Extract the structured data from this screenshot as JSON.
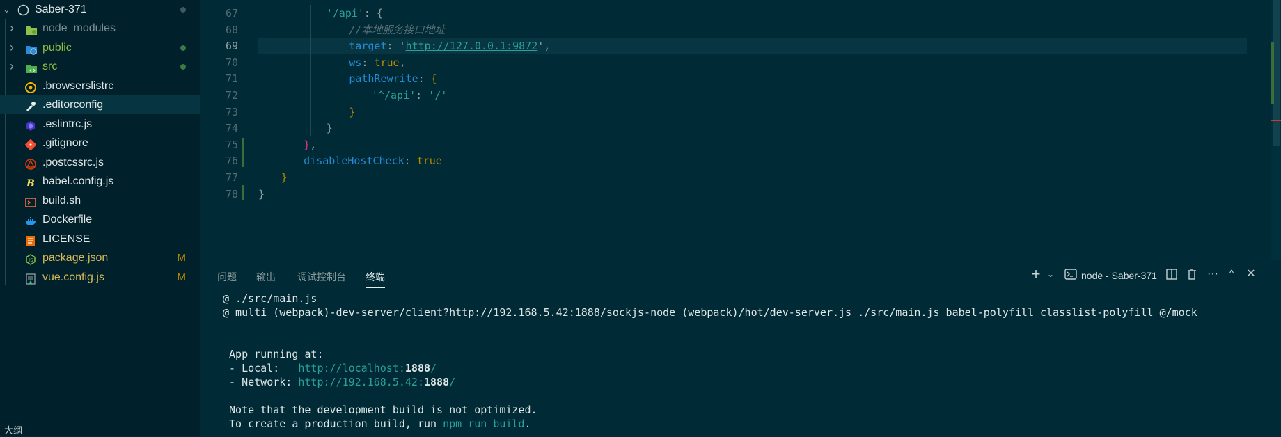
{
  "explorer": {
    "root_label": "Saber-371",
    "items": [
      {
        "label": "node_modules",
        "type": "folder",
        "icon": "node-folder-icon",
        "color": "#7f8c8d",
        "status": ""
      },
      {
        "label": "public",
        "type": "folder",
        "icon": "globe-folder-icon",
        "color": "#8fbf3f",
        "status": "dot"
      },
      {
        "label": "src",
        "type": "folder",
        "icon": "src-folder-icon",
        "color": "#8fbf3f",
        "status": "dot"
      },
      {
        "label": ".browserslistrc",
        "type": "file",
        "icon": "browserslist-icon",
        "color": "#e0e6e6",
        "status": ""
      },
      {
        "label": ".editorconfig",
        "type": "file",
        "icon": "editorconfig-icon",
        "color": "#e0e6e6",
        "status": ""
      },
      {
        "label": ".eslintrc.js",
        "type": "file",
        "icon": "eslint-icon",
        "color": "#e0e6e6",
        "status": ""
      },
      {
        "label": ".gitignore",
        "type": "file",
        "icon": "git-icon",
        "color": "#e0e6e6",
        "status": ""
      },
      {
        "label": ".postcssrc.js",
        "type": "file",
        "icon": "postcss-icon",
        "color": "#e0e6e6",
        "status": ""
      },
      {
        "label": "babel.config.js",
        "type": "file",
        "icon": "babel-icon",
        "color": "#e0e6e6",
        "status": ""
      },
      {
        "label": "build.sh",
        "type": "file",
        "icon": "shell-icon",
        "color": "#e0e6e6",
        "status": ""
      },
      {
        "label": "Dockerfile",
        "type": "file",
        "icon": "docker-icon",
        "color": "#e0e6e6",
        "status": ""
      },
      {
        "label": "LICENSE",
        "type": "file",
        "icon": "license-icon",
        "color": "#e0e6e6",
        "status": ""
      },
      {
        "label": "package.json",
        "type": "file",
        "icon": "nodejs-icon",
        "color": "#d8b85a",
        "status": "M"
      },
      {
        "label": "vue.config.js",
        "type": "file",
        "icon": "vue-config-icon",
        "color": "#d8b85a",
        "status": "M"
      }
    ],
    "selected_index": 4,
    "outline_label": "大纲"
  },
  "editor": {
    "lines": [
      {
        "num": "67",
        "indent": 6,
        "tokens": [
          [
            "'/api'",
            "str"
          ],
          [
            ": ",
            "punc"
          ],
          [
            "{",
            "brace"
          ]
        ]
      },
      {
        "num": "68",
        "indent": 8,
        "tokens": [
          [
            "//本地服务接口地址",
            "cmt"
          ]
        ]
      },
      {
        "num": "69",
        "indent": 8,
        "tokens": [
          [
            "target",
            "key"
          ],
          [
            ": '",
            "punc"
          ],
          [
            "http://127.0.0.1:9872",
            "url"
          ],
          [
            "',",
            "punc"
          ]
        ]
      },
      {
        "num": "70",
        "indent": 8,
        "tokens": [
          [
            "ws",
            "key"
          ],
          [
            ": ",
            "punc"
          ],
          [
            "true",
            "bool"
          ],
          [
            ",",
            "punc"
          ]
        ]
      },
      {
        "num": "71",
        "indent": 8,
        "tokens": [
          [
            "pathRewrite",
            "key"
          ],
          [
            ": ",
            "punc"
          ],
          [
            "{",
            "brace2"
          ]
        ]
      },
      {
        "num": "72",
        "indent": 10,
        "tokens": [
          [
            "'^/api'",
            "str"
          ],
          [
            ": ",
            "punc"
          ],
          [
            "'/'",
            "str"
          ]
        ]
      },
      {
        "num": "73",
        "indent": 8,
        "tokens": [
          [
            "}",
            "brace2"
          ]
        ]
      },
      {
        "num": "74",
        "indent": 6,
        "tokens": [
          [
            "}",
            "brace"
          ]
        ]
      },
      {
        "num": "75",
        "indent": 4,
        "tokens": [
          [
            "}",
            "brace3"
          ],
          [
            ",",
            "punc"
          ]
        ]
      },
      {
        "num": "76",
        "indent": 4,
        "tokens": [
          [
            "disableHostCheck",
            "key"
          ],
          [
            ": ",
            "punc"
          ],
          [
            "true",
            "bool"
          ]
        ]
      },
      {
        "num": "77",
        "indent": 2,
        "tokens": [
          [
            "}",
            "brace2"
          ]
        ]
      },
      {
        "num": "78",
        "indent": 0,
        "tokens": [
          [
            "}",
            "brace"
          ]
        ]
      }
    ],
    "current_line": "69"
  },
  "panel": {
    "tabs": [
      "问题",
      "输出",
      "调试控制台",
      "终端"
    ],
    "active_tab": "终端",
    "terminal_label": "node - Saber-371",
    "lines": [
      [
        [
          "@ ./src/main.js",
          "plain"
        ]
      ],
      [
        [
          "@ multi (webpack)-dev-server/client?http://192.168.5.42:1888/sockjs-node (webpack)/hot/dev-server.js ./src/main.js babel-polyfill classlist-polyfill @/mock",
          "plain"
        ]
      ],
      [
        [
          "",
          "plain"
        ]
      ],
      [
        [
          "",
          "plain"
        ]
      ],
      [
        [
          " App running at:",
          "plain"
        ]
      ],
      [
        [
          " - Local:   ",
          "plain"
        ],
        [
          "http://localhost:",
          "link"
        ],
        [
          "1888",
          "bold"
        ],
        [
          "/",
          "link"
        ]
      ],
      [
        [
          " - Network: ",
          "plain"
        ],
        [
          "http://192.168.5.42:",
          "link"
        ],
        [
          "1888",
          "bold"
        ],
        [
          "/",
          "link"
        ]
      ],
      [
        [
          "",
          "plain"
        ]
      ],
      [
        [
          " Note that the development build is not optimized.",
          "plain"
        ]
      ],
      [
        [
          " To create a production build, run ",
          "plain"
        ],
        [
          "npm run build",
          "cyan"
        ],
        [
          ".",
          "plain"
        ]
      ]
    ]
  }
}
